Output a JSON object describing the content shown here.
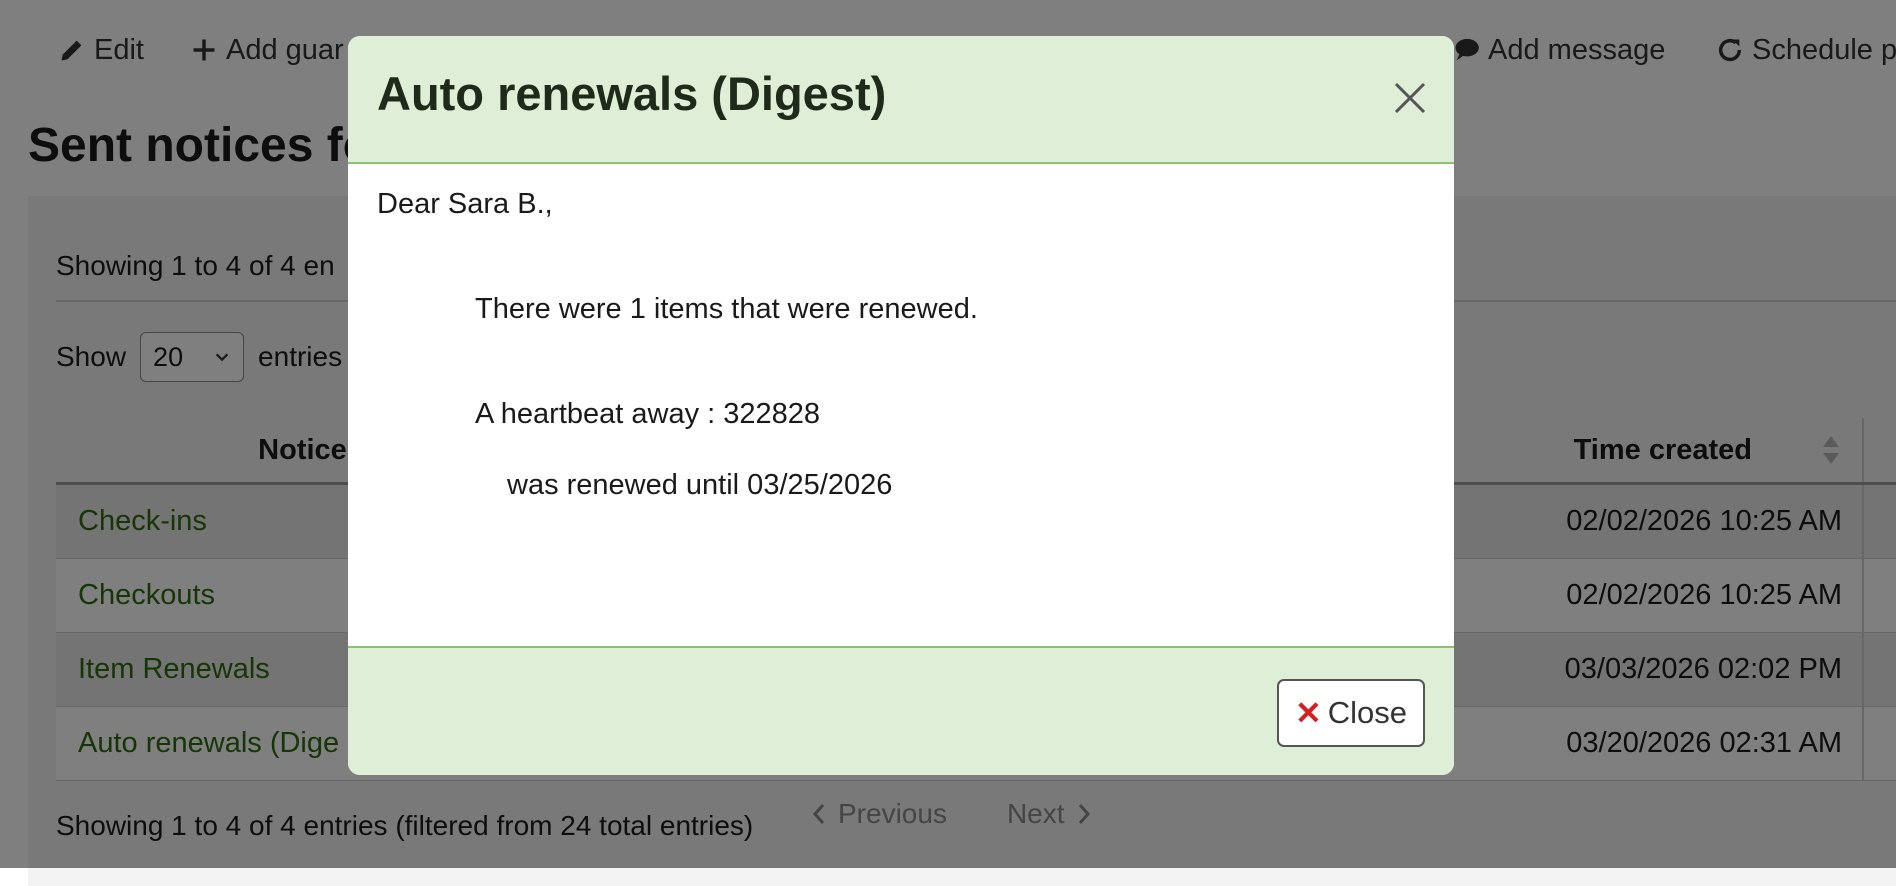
{
  "toolbar": {
    "edit_label": "Edit",
    "add_guarantor_label": "Add guar",
    "add_message_label": "Add message",
    "schedule_label": "Schedule p"
  },
  "page": {
    "title": "Sent notices fo",
    "info_top": "Showing 1 to 4 of 4 en",
    "show_label": "Show",
    "show_value": "20",
    "entries_label": "entries",
    "info_bottom": "Showing 1 to 4 of 4 entries (filtered from 24 total entries)",
    "previous_label": "Previous",
    "next_label": "Next"
  },
  "table": {
    "headers": {
      "notice": "Notice",
      "time_created": "Time created"
    },
    "rows": [
      {
        "notice": "Check-ins",
        "time": "02/02/2026 10:25 AM"
      },
      {
        "notice": "Checkouts",
        "time": "02/02/2026 10:25 AM"
      },
      {
        "notice": "Item Renewals",
        "time": "03/03/2026 02:02 PM"
      },
      {
        "notice": "Auto renewals (Dige",
        "time": "03/20/2026 02:31 AM"
      }
    ]
  },
  "modal": {
    "title": "Auto renewals (Digest)",
    "greeting": "Dear Sara B.,",
    "summary": "There were 1 items that were renewed.",
    "item": "A heartbeat away : 322828",
    "renewed": "was renewed until 03/25/2026",
    "close_label": "Close"
  },
  "colors": {
    "modal_header_bg": "#dfeed6",
    "modal_border": "#8cc26b",
    "link": "#2f6d0f",
    "close_x": "#d42020"
  }
}
